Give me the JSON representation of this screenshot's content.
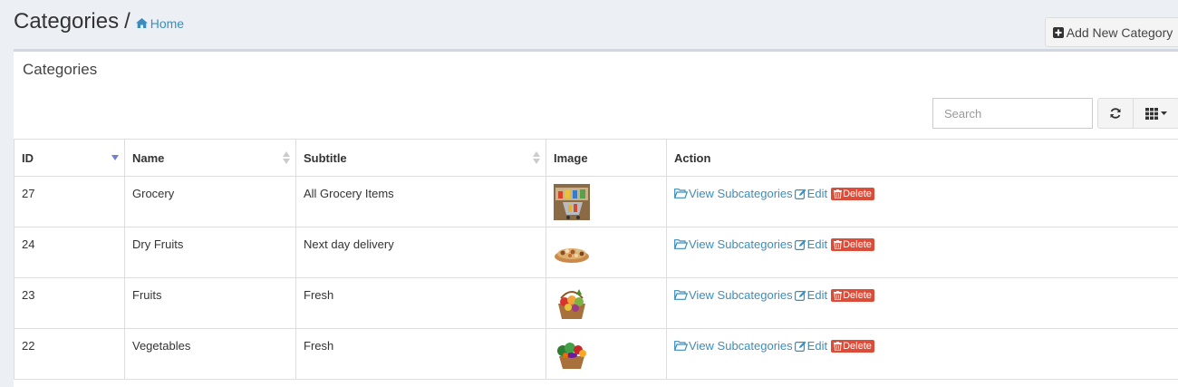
{
  "header": {
    "title": "Categories",
    "separator": "/",
    "breadcrumb": "Home",
    "add_button": "Add New Category"
  },
  "box": {
    "title": "Categories",
    "search_placeholder": "Search"
  },
  "table": {
    "columns": [
      "ID",
      "Name",
      "Subtitle",
      "Image",
      "Action"
    ],
    "rows": [
      {
        "id": "27",
        "name": "Grocery",
        "subtitle": "All Grocery Items",
        "image": "grocery-cart-photo"
      },
      {
        "id": "24",
        "name": "Dry Fruits",
        "subtitle": "Next day delivery",
        "image": "dry-fruits-bowl-photo"
      },
      {
        "id": "23",
        "name": "Fruits",
        "subtitle": "Fresh",
        "image": "fruit-basket-photo"
      },
      {
        "id": "22",
        "name": "Vegetables",
        "subtitle": "Fresh",
        "image": "vegetable-basket-photo"
      }
    ],
    "actions": {
      "view": "View Subcategories",
      "edit": "Edit",
      "delete": "Delete"
    }
  },
  "colors": {
    "link": "#3c8dbc",
    "danger": "#dd4b39",
    "background": "#ecf0f5",
    "sort_active": "#6f7fd1"
  },
  "icons": {
    "breadcrumb": "home-icon",
    "add": "plus-square-icon",
    "refresh": "refresh-icon",
    "columns": "grid-icon",
    "view": "folder-open-icon",
    "edit": "edit-icon",
    "delete": "trash-icon"
  }
}
